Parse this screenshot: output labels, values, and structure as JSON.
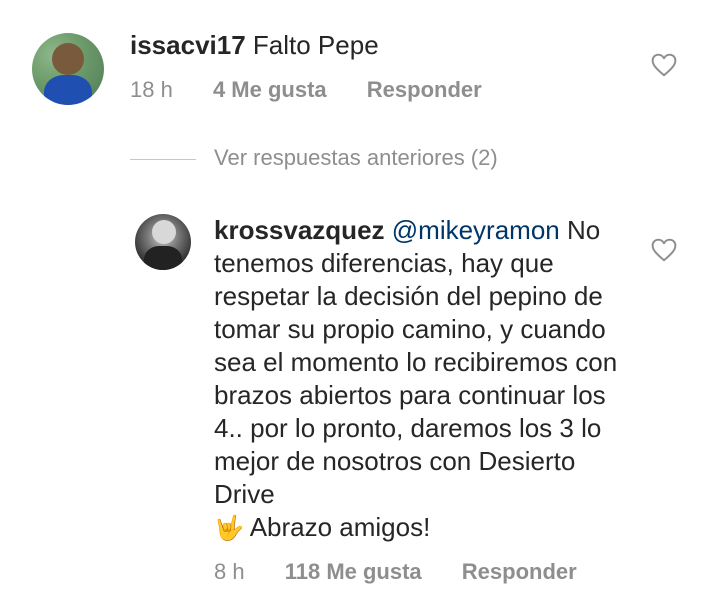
{
  "comments": [
    {
      "username": "issacvi17",
      "text": "Falto Pepe",
      "time": "18 h",
      "likes": "4 Me gusta",
      "reply_label": "Responder",
      "like_icon": "heart-outline-icon"
    },
    {
      "username": "krossvazquez",
      "mention": "@mikeyramon",
      "text": "No tenemos diferencias, hay que respetar la decisión del pepino de tomar su propio camino, y cuando sea el momento lo recibiremos con brazos abiertos para continuar los 4.. por lo pronto, daremos los 3 lo mejor de nosotros con Desierto Drive",
      "emoji": "🤟",
      "text_end": "Abrazo amigos!",
      "time": "8 h",
      "likes": "118 Me gusta",
      "reply_label": "Responder",
      "like_icon": "heart-outline-icon"
    }
  ],
  "view_previous_replies": "Ver respuestas anteriores (2)",
  "colors": {
    "text": "#262626",
    "meta": "#8e8e8e",
    "mention": "#003569",
    "divider": "#c7c7c7"
  }
}
